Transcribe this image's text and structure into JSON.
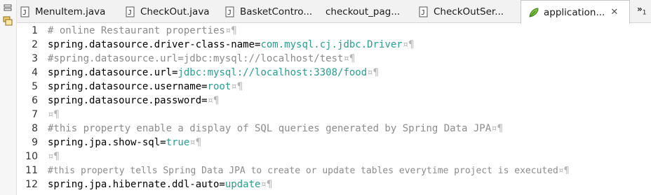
{
  "tabs": [
    {
      "label": "MenuItem.java",
      "icon": "java-file-icon",
      "active": false
    },
    {
      "label": "CheckOut.java",
      "icon": "java-file-icon",
      "active": false
    },
    {
      "label": "BasketContro...",
      "icon": "java-file-icon",
      "active": false
    },
    {
      "label": "checkout_pag...",
      "icon": "none",
      "active": false
    },
    {
      "label": "CheckOutSer...",
      "icon": "java-file-icon",
      "active": false
    },
    {
      "label": "application...",
      "icon": "properties-leaf-icon",
      "active": true,
      "close": "✕"
    }
  ],
  "overflow": {
    "symbol": "»",
    "count": "1"
  },
  "lines": [
    {
      "num": "1",
      "comment": "# online Restaurant properties",
      "eol": "¤¶"
    },
    {
      "num": "2",
      "key": "spring.datasource.driver-class-name=",
      "value": "com.mysql.cj.jdbc.Driver",
      "eol": "¤¶"
    },
    {
      "num": "3",
      "comment": "#spring.datasource.url=jdbc:mysql://localhost/test",
      "eol": "¤¶"
    },
    {
      "num": "4",
      "key": "spring.datasource.url=",
      "value": "jdbc:mysql://localhost:3308/food",
      "eol": "¤¶"
    },
    {
      "num": "5",
      "key": "spring.datasource.username=",
      "value": "root",
      "eol": "¤¶"
    },
    {
      "num": "6",
      "key": "spring.datasource.password=",
      "value": "",
      "eol": "¤¶"
    },
    {
      "num": "7",
      "eol": "¤¶"
    },
    {
      "num": "8",
      "comment": "#this property enable a display of SQL queries generated by Spring Data JPA",
      "eol": "¤¶"
    },
    {
      "num": "9",
      "key": "spring.jpa.show-sql=",
      "value": "true",
      "eol": "¤¶"
    },
    {
      "num": "10",
      "eol": "¤¶"
    },
    {
      "num": "11",
      "comment": "#this property tells Spring Data JPA to create or update tables everytime project is executed",
      "eol": "¤¶"
    },
    {
      "num": "12",
      "key": "spring.jpa.hibernate.ddl-auto=",
      "value": "update",
      "eol": "¤¶"
    }
  ],
  "colors": {
    "value": "#2a9d8f",
    "comment": "#8c8c8c",
    "whitespace": "#b5b5b5"
  }
}
